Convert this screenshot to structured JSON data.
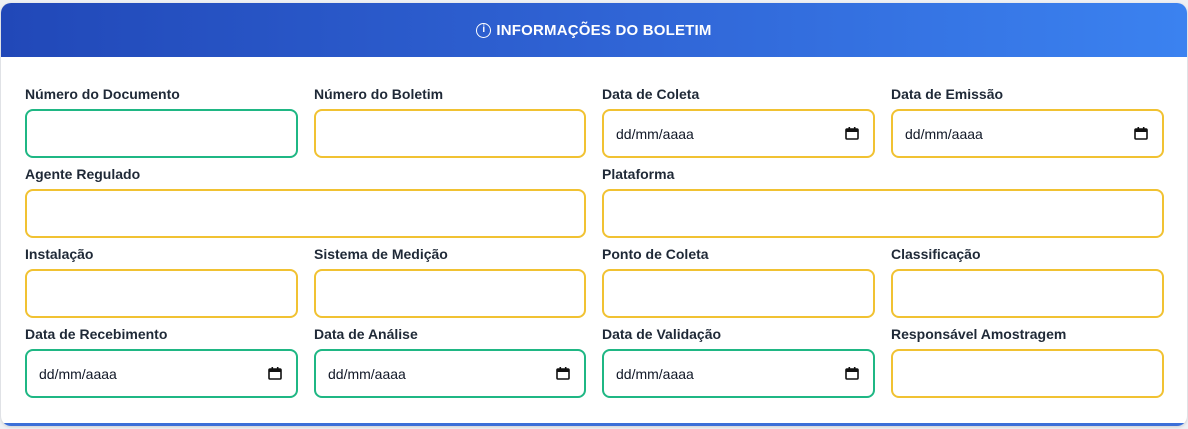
{
  "header": {
    "title": "INFORMAÇÕES DO BOLETIM",
    "icon": "info-icon"
  },
  "colors": {
    "header_start": "#2148b8",
    "header_end": "#3b82f0",
    "border_yellow": "#f1c232",
    "border_green": "#1fb784"
  },
  "fields": {
    "numero_documento": {
      "label": "Número do Documento",
      "value": ""
    },
    "numero_boletim": {
      "label": "Número do Boletim",
      "value": ""
    },
    "data_coleta": {
      "label": "Data de Coleta",
      "placeholder": "dd/mm/aaaa"
    },
    "data_emissao": {
      "label": "Data de Emissão",
      "placeholder": "dd/mm/aaaa"
    },
    "agente_regulado": {
      "label": "Agente Regulado",
      "value": ""
    },
    "plataforma": {
      "label": "Plataforma",
      "value": ""
    },
    "instalacao": {
      "label": "Instalação",
      "value": ""
    },
    "sistema_medicao": {
      "label": "Sistema de Medição",
      "value": ""
    },
    "ponto_coleta": {
      "label": "Ponto de Coleta",
      "value": ""
    },
    "classificacao": {
      "label": "Classificação",
      "value": ""
    },
    "data_recebimento": {
      "label": "Data de Recebimento",
      "placeholder": "dd/mm/aaaa"
    },
    "data_analise": {
      "label": "Data de Análise",
      "placeholder": "dd/mm/aaaa"
    },
    "data_validacao": {
      "label": "Data de Validação",
      "placeholder": "dd/mm/aaaa"
    },
    "responsavel_amostragem": {
      "label": "Responsável Amostragem",
      "value": ""
    }
  }
}
